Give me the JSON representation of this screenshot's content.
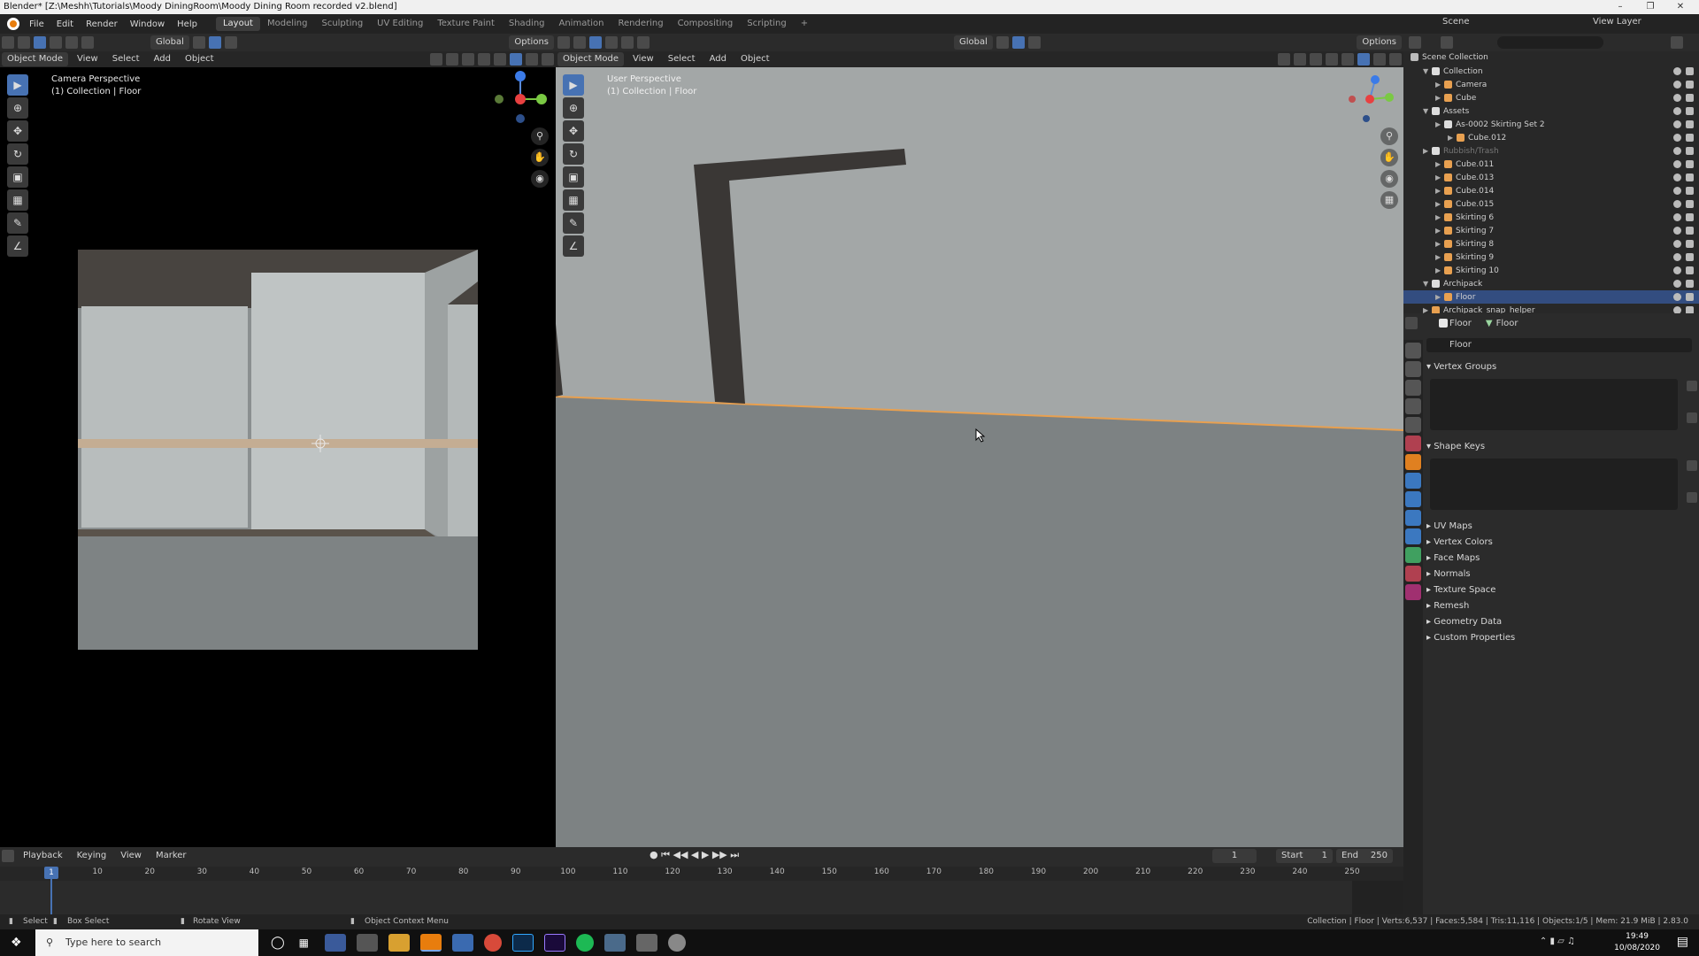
{
  "window": {
    "title": "Blender* [Z:\\Meshh\\Tutorials\\Moody DiningRoom\\Moody Dining Room recorded v2.blend]"
  },
  "menu": {
    "items": [
      "File",
      "Edit",
      "Render",
      "Window",
      "Help"
    ],
    "workspaces": [
      "Layout",
      "Modeling",
      "Sculpting",
      "UV Editing",
      "Texture Paint",
      "Shading",
      "Animation",
      "Rendering",
      "Compositing",
      "Scripting"
    ],
    "active_workspace": "Layout",
    "add_workspace": "+",
    "scene_label": "Scene",
    "view_layer_label": "View Layer"
  },
  "left_viewport": {
    "mode": "Object Mode",
    "menus": [
      "View",
      "Select",
      "Add",
      "Object"
    ],
    "orientation": "Global",
    "options": "Options",
    "overlay_title": "Camera Perspective",
    "overlay_subtitle": "(1) Collection | Floor"
  },
  "right_viewport": {
    "mode": "Object Mode",
    "menus": [
      "View",
      "Select",
      "Add",
      "Object"
    ],
    "orientation": "Global",
    "options": "Options",
    "overlay_title": "User Perspective",
    "overlay_subtitle": "(1) Collection | Floor"
  },
  "outliner": {
    "root": "Scene Collection",
    "rows": [
      {
        "label": "Collection",
        "indent": 1,
        "expanded": true,
        "kind": "collection"
      },
      {
        "label": "Camera",
        "indent": 2,
        "kind": "object"
      },
      {
        "label": "Cube",
        "indent": 2,
        "kind": "object"
      },
      {
        "label": "Assets",
        "indent": 1,
        "expanded": true,
        "kind": "collection"
      },
      {
        "label": "As-0002 Skirting Set 2",
        "indent": 2,
        "kind": "collection"
      },
      {
        "label": "Cube.012",
        "indent": 3,
        "kind": "object"
      },
      {
        "label": "Rubbish/Trash",
        "indent": 1,
        "kind": "collection",
        "dim": true
      },
      {
        "label": "Cube.011",
        "indent": 2,
        "kind": "object"
      },
      {
        "label": "Cube.013",
        "indent": 2,
        "kind": "object"
      },
      {
        "label": "Cube.014",
        "indent": 2,
        "kind": "object"
      },
      {
        "label": "Cube.015",
        "indent": 2,
        "kind": "object"
      },
      {
        "label": "Skirting 6",
        "indent": 2,
        "kind": "object"
      },
      {
        "label": "Skirting 7",
        "indent": 2,
        "kind": "object"
      },
      {
        "label": "Skirting 8",
        "indent": 2,
        "kind": "object"
      },
      {
        "label": "Skirting 9",
        "indent": 2,
        "kind": "object"
      },
      {
        "label": "Skirting 10",
        "indent": 2,
        "kind": "object"
      },
      {
        "label": "Archipack",
        "indent": 1,
        "expanded": true,
        "kind": "collection"
      },
      {
        "label": "Floor",
        "indent": 2,
        "kind": "object",
        "selected": true
      },
      {
        "label": "Archipack_snap_helper",
        "indent": 1,
        "kind": "object"
      }
    ]
  },
  "properties": {
    "breadcrumb_object": "Floor",
    "breadcrumb_data": "Floor",
    "data_name": "Floor",
    "panels_open": [
      "Vertex Groups",
      "Shape Keys"
    ],
    "panels_closed": [
      "UV Maps",
      "Vertex Colors",
      "Face Maps",
      "Normals",
      "Texture Space",
      "Remesh",
      "Geometry Data",
      "Custom Properties"
    ]
  },
  "timeline": {
    "menus": [
      "Playback",
      "Keying",
      "View",
      "Marker"
    ],
    "current_frame": "1",
    "start_label": "Start",
    "start": "1",
    "end_label": "End",
    "end": "250",
    "ticks": [
      "10",
      "20",
      "30",
      "40",
      "50",
      "60",
      "70",
      "80",
      "90",
      "100",
      "110",
      "120",
      "130",
      "140",
      "150",
      "160",
      "170",
      "180",
      "190",
      "200",
      "210",
      "220",
      "230",
      "240",
      "250"
    ],
    "playhead_frame": "1"
  },
  "status": {
    "select": "Select",
    "box_select": "Box Select",
    "rotate_view": "Rotate View",
    "context_menu": "Object Context Menu",
    "stats": "Collection | Floor | Verts:6,537 | Faces:5,584 | Tris:11,116 | Objects:1/5 | Mem: 21.9 MiB | 2.83.0"
  },
  "taskbar": {
    "search_placeholder": "Type here to search",
    "time": "19:49",
    "date": "10/08/2020"
  },
  "colors": {
    "accent": "#4772b3",
    "selection_orange": "#e8a050",
    "viewport_grey": "#8a8e8f"
  }
}
